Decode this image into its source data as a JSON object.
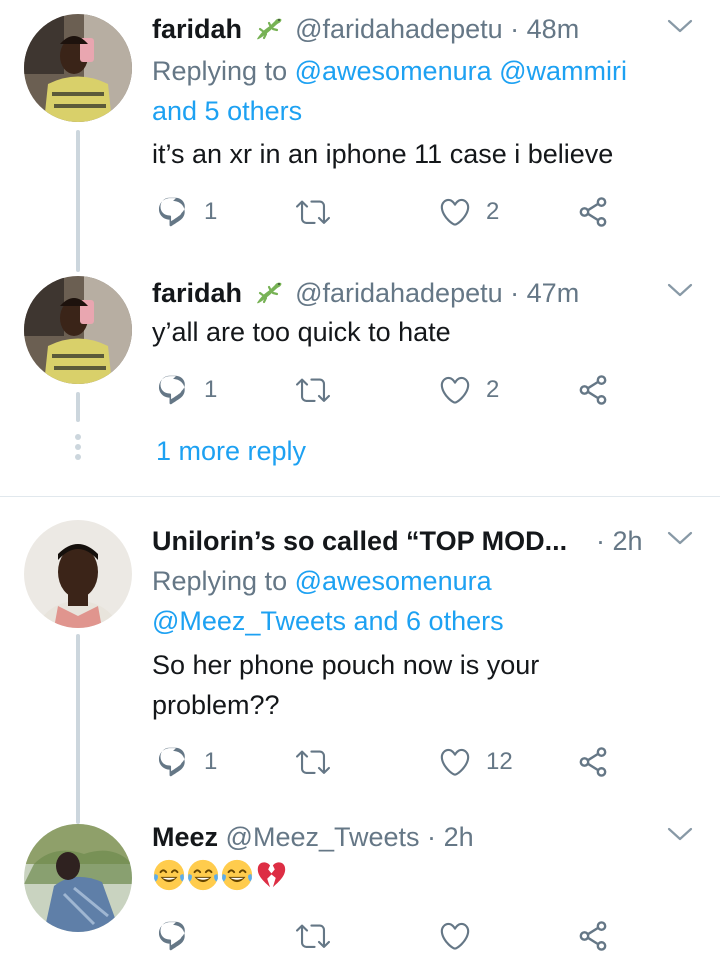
{
  "tweets": [
    {
      "name": "faridah",
      "handle": "@faridahadepetu",
      "dot": "·",
      "time": "48m",
      "replying_prefix": "Replying to",
      "replying_line1_users": "@awesomenura @wammiri",
      "replying_line2": "and 5 others",
      "text": "it’s an xr in an iphone 11 case i believe",
      "reply_count": "1",
      "retweet_count": "",
      "like_count": "2"
    },
    {
      "name": "faridah",
      "handle": "@faridahadepetu",
      "dot": "·",
      "time": "47m",
      "text": "y’all are too quick to hate",
      "reply_count": "1",
      "retweet_count": "",
      "like_count": "2"
    },
    {
      "name": "Unilorin’s so called “TOP MOD...",
      "handle": "",
      "dot": "·",
      "time": "2h",
      "replying_prefix": "Replying to",
      "replying_line1_users": "@awesomenura",
      "replying_line2": "@Meez_Tweets and 6 others",
      "text_line1": "So her phone pouch now is your",
      "text_line2": "problem??",
      "reply_count": "1",
      "retweet_count": "",
      "like_count": "12"
    },
    {
      "name": "Meez",
      "handle": "@Meez_Tweets",
      "dot": "·",
      "time": "2h",
      "reply_count": "",
      "retweet_count": "",
      "like_count": ""
    }
  ],
  "more_replies_label": "1 more reply",
  "emojis": [
    "face-with-tears-of-joy",
    "face-with-tears-of-joy",
    "face-with-tears-of-joy",
    "broken-heart"
  ],
  "colors": {
    "link": "#1da1f2",
    "secondary": "#657786",
    "thread_line": "#ccd6dd",
    "lizard": "#77b255"
  },
  "icons": {
    "reply": "reply-icon",
    "retweet": "retweet-icon",
    "like": "heart-icon",
    "share": "share-icon",
    "caret": "chevron-down-icon",
    "badge": "lizard-emoji-icon"
  }
}
